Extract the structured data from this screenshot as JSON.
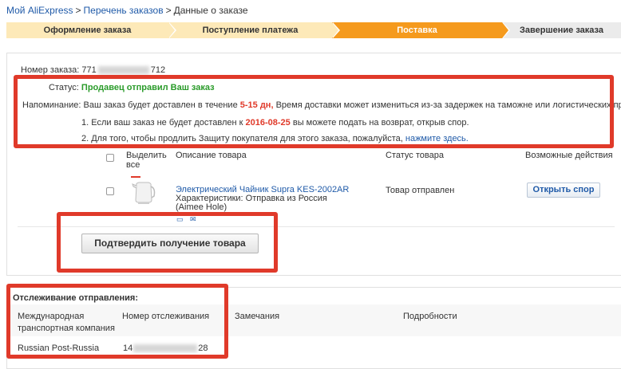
{
  "breadcrumb": {
    "home": "Мой AliExpress",
    "orders": "Перечень заказов",
    "current": "Данные о заказе",
    "separator": ">"
  },
  "steps": [
    {
      "label": "Оформление заказа",
      "state": "done"
    },
    {
      "label": "Поступление платежа",
      "state": "done"
    },
    {
      "label": "Поставка",
      "state": "active"
    },
    {
      "label": "Завершение заказа",
      "state": "pending"
    }
  ],
  "order": {
    "number_label": "Номер заказа:",
    "number_prefix": "771",
    "number_suffix": "712",
    "status_label": "Статус:",
    "status_value": "Продавец отправил Ваш заказ",
    "reminder_label": "Напоминание:",
    "reminder_text_1": "Ваш заказ будет доставлен в течение",
    "reminder_days": "5-15 дн,",
    "reminder_text_2": "Время доставки может измениться из-за задержек на таможне или логистических пробле",
    "note1_text": "1. Если ваш заказ не будет доставлен к",
    "note1_date": "2016-08-25",
    "note1_tail": "вы можете подать на возврат, открыв спор.",
    "note2_text": "2. Для того, чтобы продлить Защиту покупателя для этого заказа, пожалуйста,",
    "note2_link": "нажмите здесь."
  },
  "table": {
    "select_all": "Выделить все",
    "col_description": "Описание товара",
    "col_status": "Статус товара",
    "col_actions": "Возможные действия",
    "items": [
      {
        "title": "Электрический Чайник Supra KES-2002AR",
        "characteristics": "Характеристики: Отправка из Россия",
        "seller": "(Aimee Hole)",
        "status": "Товар отправлен",
        "action": "Открыть спор"
      }
    ]
  },
  "confirm_button": "Подтвердить получение товара",
  "tracking": {
    "title": "Отслеживание отправления:",
    "col_company_1": "Международная",
    "col_company_2": "транспортная компания",
    "col_number": "Номер отслеживания",
    "col_notes": "Замечания",
    "col_details": "Подробности",
    "company": "Russian Post-Russia",
    "number_prefix": "14",
    "number_suffix": "28"
  },
  "colors": {
    "accent_orange": "#f59a1d",
    "step_done": "#fde9b8",
    "highlight_red": "#e03a2a",
    "status_green": "#2a9b2a",
    "link_blue": "#1f5aa8"
  }
}
